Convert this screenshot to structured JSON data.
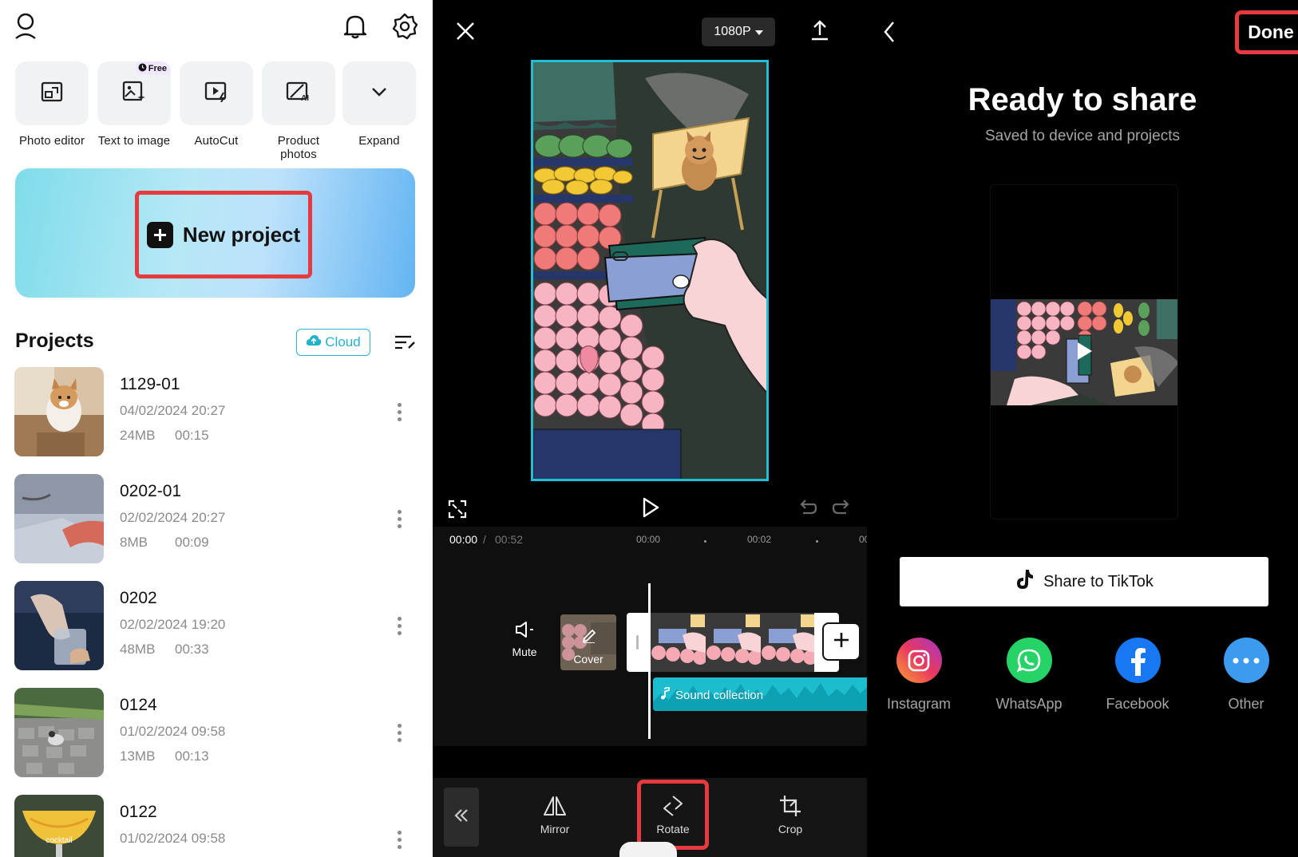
{
  "home": {
    "tools": [
      {
        "label": "Photo editor",
        "icon": "photo-editor-icon"
      },
      {
        "label": "Text to image",
        "icon": "text-to-image-icon",
        "badge": "Free"
      },
      {
        "label": "AutoCut",
        "icon": "autocut-icon"
      },
      {
        "label": "Product photos",
        "icon": "product-photos-icon"
      },
      {
        "label": "Expand",
        "icon": "chevron-down-icon"
      }
    ],
    "new_project_label": "New project",
    "projects_title": "Projects",
    "cloud_label": "Cloud",
    "projects": [
      {
        "name": "1129-01",
        "date": "04/02/2024 20:27",
        "size": "24MB",
        "duration": "00:15"
      },
      {
        "name": "0202-01",
        "date": "02/02/2024 20:27",
        "size": "8MB",
        "duration": "00:09"
      },
      {
        "name": "0202",
        "date": "02/02/2024 19:20",
        "size": "48MB",
        "duration": "00:33"
      },
      {
        "name": "0124",
        "date": "01/02/2024 09:58",
        "size": "13MB",
        "duration": "00:13"
      },
      {
        "name": "0122",
        "date": "01/02/2024 09:58",
        "size": "",
        "duration": "",
        "thumb_text": "cocktail"
      }
    ]
  },
  "editor": {
    "resolution": "1080P",
    "time_current": "00:00",
    "time_separator": "/",
    "time_total": "00:52",
    "ticks": [
      "00:00",
      "00:02",
      "00"
    ],
    "mute_label": "Mute",
    "cover_label": "Cover",
    "audio_label": "Sound collection",
    "toolbar": [
      {
        "label": "Mirror",
        "icon": "mirror-icon"
      },
      {
        "label": "Rotate",
        "icon": "rotate-icon"
      },
      {
        "label": "Crop",
        "icon": "crop-icon"
      }
    ]
  },
  "share": {
    "done_label": "Done",
    "title": "Ready to share",
    "subtitle": "Saved to device and projects",
    "tiktok_label": "Share to TikTok",
    "targets": [
      {
        "label": "Instagram",
        "icon": "instagram-icon"
      },
      {
        "label": "WhatsApp",
        "icon": "whatsapp-icon",
        "color": "#25d366"
      },
      {
        "label": "Facebook",
        "icon": "facebook-icon",
        "color": "#1877f2"
      },
      {
        "label": "Other",
        "icon": "more-icon",
        "color": "#3d9bef"
      }
    ]
  },
  "colors": {
    "highlight": "#e63a3e",
    "accent_cyan": "#1fc0d3"
  }
}
